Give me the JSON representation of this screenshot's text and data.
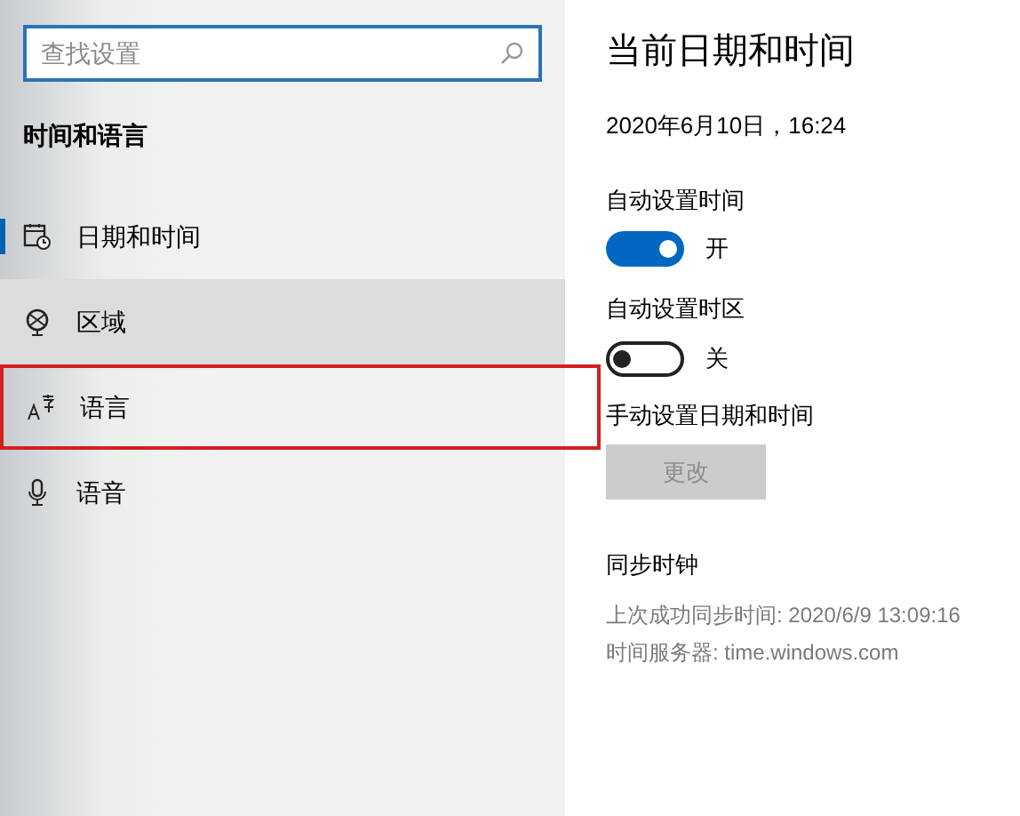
{
  "sidebar": {
    "search": {
      "placeholder": "查找设置"
    },
    "heading": "时间和语言",
    "items": [
      {
        "label": "日期和时间",
        "kind": "calendar",
        "selected": true,
        "hovered": false,
        "highlighted": false
      },
      {
        "label": "区域",
        "kind": "globe",
        "selected": false,
        "hovered": true,
        "highlighted": false
      },
      {
        "label": "语言",
        "kind": "language",
        "selected": false,
        "hovered": false,
        "highlighted": true
      },
      {
        "label": "语音",
        "kind": "microphone",
        "selected": false,
        "hovered": false,
        "highlighted": false
      }
    ]
  },
  "content": {
    "title": "当前日期和时间",
    "current": "2020年6月10日，16:24",
    "toggles": [
      {
        "label": "自动设置时间",
        "on": true,
        "state_text": "开"
      },
      {
        "label": "自动设置时区",
        "on": false,
        "state_text": "关"
      }
    ],
    "manual": {
      "label": "手动设置日期和时间",
      "button": "更改",
      "disabled": true
    },
    "sync": {
      "heading": "同步时钟",
      "last_sync": "上次成功同步时间: 2020/6/9 13:09:16",
      "server": "时间服务器: time.windows.com"
    }
  }
}
